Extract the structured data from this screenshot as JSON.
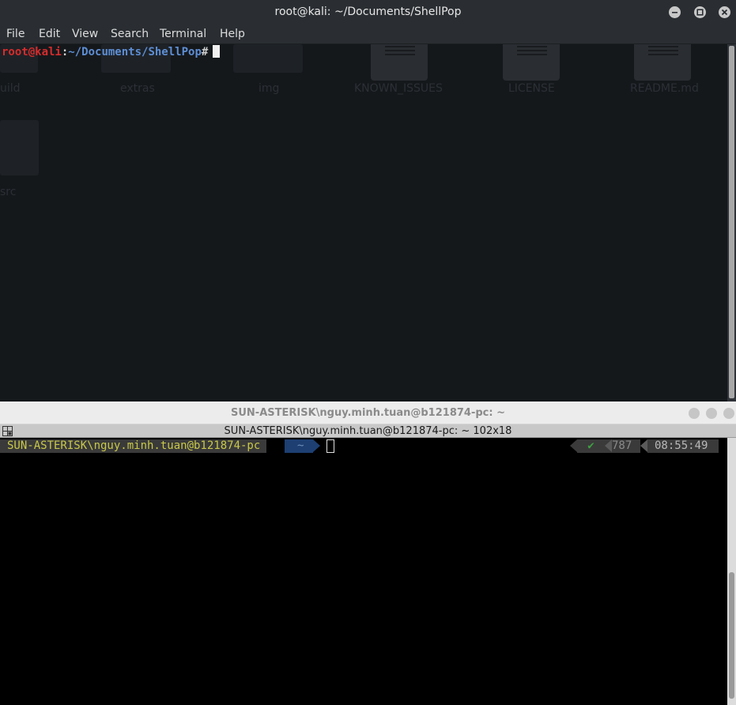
{
  "kali": {
    "title": "root@kali: ~/Documents/ShellPop",
    "menu": {
      "file": "File",
      "edit": "Edit",
      "view": "View",
      "search": "Search",
      "terminal": "Terminal",
      "help": "Help"
    },
    "prompt": {
      "user_host": "root@kali",
      "separator": ":",
      "path": "~/Documents/ShellPop",
      "symbol": "#"
    },
    "desktop_labels": {
      "build": "uild",
      "extras": "extras",
      "img": "img",
      "known_issues": "KNOWN_ISSUES",
      "license": "LICENSE",
      "readme": "README.md",
      "src": "src"
    },
    "colors": {
      "user": "#d62c2c",
      "path": "#5d8ed4",
      "background": "#15181b"
    }
  },
  "sun": {
    "window_title": "SUN-ASTERISK\\nguy.minh.tuan@b121874-pc: ~",
    "tab_title": "SUN-ASTERISK\\nguy.minh.tuan@b121874-pc: ~ 102x18",
    "prompt": {
      "user_host": "SUN-ASTERISK\\nguy.minh.tuan@b121874-pc",
      "dir": "~",
      "status": "✔",
      "history_count": "787",
      "time": "08:55:49"
    },
    "colors": {
      "user_fg": "#c8c84a",
      "segment_bg": "#3a3a3a",
      "dir_bg": "#1d3f72",
      "status_ok": "#3fa142"
    }
  }
}
